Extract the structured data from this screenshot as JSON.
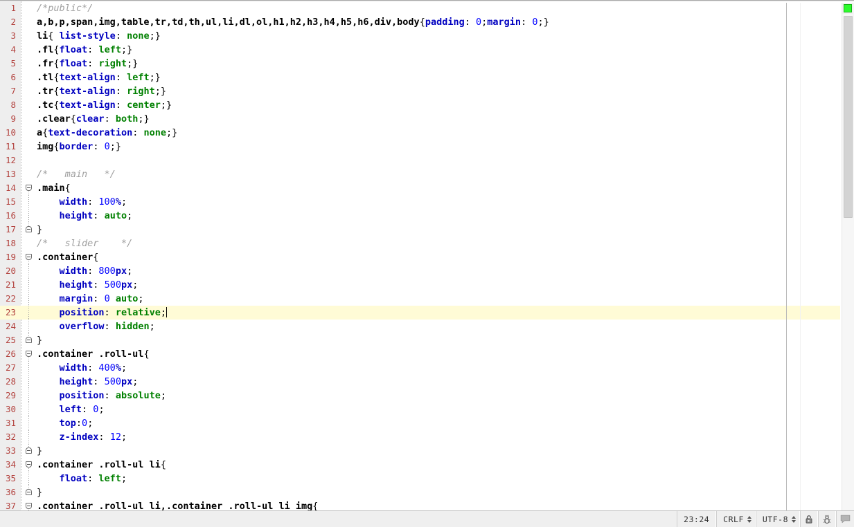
{
  "app": {
    "type": "code-editor",
    "language": "CSS"
  },
  "editor": {
    "current_line": 23,
    "first_visible_line": 1,
    "colors": {
      "background": "#ffffff",
      "gutter_background": "#eeeeee",
      "line_number": "#b3433f",
      "current_line_highlight": "#fffbd6",
      "selector": "#000000",
      "property": "#0000c0",
      "value_keyword": "#008000",
      "number": "#0000ff",
      "comment": "#a0a0a0",
      "caret": "#000000"
    },
    "lines": [
      {
        "n": 1,
        "fold": "none",
        "tokens": [
          {
            "t": "com",
            "s": "/*public*/"
          }
        ]
      },
      {
        "n": 2,
        "fold": "none",
        "tokens": [
          {
            "t": "sel",
            "s": "a,b,p,span,img,table,tr,td,th,ul,li,dl,ol,h1,h2,h3,h4,h5,h6,div,body"
          },
          {
            "t": "punc",
            "s": "{"
          },
          {
            "t": "prop",
            "s": "padding"
          },
          {
            "t": "punc",
            "s": ": "
          },
          {
            "t": "num",
            "s": "0"
          },
          {
            "t": "punc",
            "s": ";"
          },
          {
            "t": "prop",
            "s": "margin"
          },
          {
            "t": "punc",
            "s": ": "
          },
          {
            "t": "num",
            "s": "0"
          },
          {
            "t": "punc",
            "s": ";}"
          }
        ]
      },
      {
        "n": 3,
        "fold": "none",
        "tokens": [
          {
            "t": "sel",
            "s": "li"
          },
          {
            "t": "punc",
            "s": "{ "
          },
          {
            "t": "prop",
            "s": "list-style"
          },
          {
            "t": "punc",
            "s": ": "
          },
          {
            "t": "val",
            "s": "none"
          },
          {
            "t": "punc",
            "s": ";}"
          }
        ]
      },
      {
        "n": 4,
        "fold": "none",
        "tokens": [
          {
            "t": "sel",
            "s": ".fl"
          },
          {
            "t": "punc",
            "s": "{"
          },
          {
            "t": "prop",
            "s": "float"
          },
          {
            "t": "punc",
            "s": ": "
          },
          {
            "t": "val",
            "s": "left"
          },
          {
            "t": "punc",
            "s": ";}"
          }
        ]
      },
      {
        "n": 5,
        "fold": "none",
        "tokens": [
          {
            "t": "sel",
            "s": ".fr"
          },
          {
            "t": "punc",
            "s": "{"
          },
          {
            "t": "prop",
            "s": "float"
          },
          {
            "t": "punc",
            "s": ": "
          },
          {
            "t": "val",
            "s": "right"
          },
          {
            "t": "punc",
            "s": ";}"
          }
        ]
      },
      {
        "n": 6,
        "fold": "none",
        "tokens": [
          {
            "t": "sel",
            "s": ".tl"
          },
          {
            "t": "punc",
            "s": "{"
          },
          {
            "t": "prop",
            "s": "text-align"
          },
          {
            "t": "punc",
            "s": ": "
          },
          {
            "t": "val",
            "s": "left"
          },
          {
            "t": "punc",
            "s": ";}"
          }
        ]
      },
      {
        "n": 7,
        "fold": "none",
        "tokens": [
          {
            "t": "sel",
            "s": ".tr"
          },
          {
            "t": "punc",
            "s": "{"
          },
          {
            "t": "prop",
            "s": "text-align"
          },
          {
            "t": "punc",
            "s": ": "
          },
          {
            "t": "val",
            "s": "right"
          },
          {
            "t": "punc",
            "s": ";}"
          }
        ]
      },
      {
        "n": 8,
        "fold": "none",
        "tokens": [
          {
            "t": "sel",
            "s": ".tc"
          },
          {
            "t": "punc",
            "s": "{"
          },
          {
            "t": "prop",
            "s": "text-align"
          },
          {
            "t": "punc",
            "s": ": "
          },
          {
            "t": "val",
            "s": "center"
          },
          {
            "t": "punc",
            "s": ";}"
          }
        ]
      },
      {
        "n": 9,
        "fold": "none",
        "tokens": [
          {
            "t": "sel",
            "s": ".clear"
          },
          {
            "t": "punc",
            "s": "{"
          },
          {
            "t": "prop",
            "s": "clear"
          },
          {
            "t": "punc",
            "s": ": "
          },
          {
            "t": "val",
            "s": "both"
          },
          {
            "t": "punc",
            "s": ";}"
          }
        ]
      },
      {
        "n": 10,
        "fold": "none",
        "tokens": [
          {
            "t": "sel",
            "s": "a"
          },
          {
            "t": "punc",
            "s": "{"
          },
          {
            "t": "prop",
            "s": "text-decoration"
          },
          {
            "t": "punc",
            "s": ": "
          },
          {
            "t": "val",
            "s": "none"
          },
          {
            "t": "punc",
            "s": ";}"
          }
        ]
      },
      {
        "n": 11,
        "fold": "none",
        "tokens": [
          {
            "t": "sel",
            "s": "img"
          },
          {
            "t": "punc",
            "s": "{"
          },
          {
            "t": "prop",
            "s": "border"
          },
          {
            "t": "punc",
            "s": ": "
          },
          {
            "t": "num",
            "s": "0"
          },
          {
            "t": "punc",
            "s": ";}"
          }
        ]
      },
      {
        "n": 12,
        "fold": "none",
        "tokens": []
      },
      {
        "n": 13,
        "fold": "none",
        "tokens": [
          {
            "t": "com",
            "s": "/*   main   */"
          }
        ]
      },
      {
        "n": 14,
        "fold": "start",
        "tokens": [
          {
            "t": "sel",
            "s": ".main"
          },
          {
            "t": "punc",
            "s": "{"
          }
        ]
      },
      {
        "n": 15,
        "fold": "none",
        "tokens": [
          {
            "t": "punc",
            "s": "    "
          },
          {
            "t": "prop",
            "s": "width"
          },
          {
            "t": "punc",
            "s": ": "
          },
          {
            "t": "num",
            "s": "100"
          },
          {
            "t": "unit",
            "s": "%"
          },
          {
            "t": "punc",
            "s": ";"
          }
        ]
      },
      {
        "n": 16,
        "fold": "none",
        "tokens": [
          {
            "t": "punc",
            "s": "    "
          },
          {
            "t": "prop",
            "s": "height"
          },
          {
            "t": "punc",
            "s": ": "
          },
          {
            "t": "val",
            "s": "auto"
          },
          {
            "t": "punc",
            "s": ";"
          }
        ]
      },
      {
        "n": 17,
        "fold": "end",
        "tokens": [
          {
            "t": "punc",
            "s": "}"
          }
        ]
      },
      {
        "n": 18,
        "fold": "none",
        "tokens": [
          {
            "t": "com",
            "s": "/*   slider    */"
          }
        ]
      },
      {
        "n": 19,
        "fold": "start",
        "tokens": [
          {
            "t": "sel",
            "s": ".container"
          },
          {
            "t": "punc",
            "s": "{"
          }
        ]
      },
      {
        "n": 20,
        "fold": "none",
        "tokens": [
          {
            "t": "punc",
            "s": "    "
          },
          {
            "t": "prop",
            "s": "width"
          },
          {
            "t": "punc",
            "s": ": "
          },
          {
            "t": "num",
            "s": "800"
          },
          {
            "t": "unit",
            "s": "px"
          },
          {
            "t": "punc",
            "s": ";"
          }
        ]
      },
      {
        "n": 21,
        "fold": "none",
        "tokens": [
          {
            "t": "punc",
            "s": "    "
          },
          {
            "t": "prop",
            "s": "height"
          },
          {
            "t": "punc",
            "s": ": "
          },
          {
            "t": "num",
            "s": "500"
          },
          {
            "t": "unit",
            "s": "px"
          },
          {
            "t": "punc",
            "s": ";"
          }
        ]
      },
      {
        "n": 22,
        "fold": "none",
        "tokens": [
          {
            "t": "punc",
            "s": "    "
          },
          {
            "t": "prop",
            "s": "margin"
          },
          {
            "t": "punc",
            "s": ": "
          },
          {
            "t": "num",
            "s": "0"
          },
          {
            "t": "punc",
            "s": " "
          },
          {
            "t": "val",
            "s": "auto"
          },
          {
            "t": "punc",
            "s": ";"
          }
        ]
      },
      {
        "n": 23,
        "fold": "none",
        "caret": true,
        "tokens": [
          {
            "t": "punc",
            "s": "    "
          },
          {
            "t": "prop",
            "s": "position"
          },
          {
            "t": "punc",
            "s": ": "
          },
          {
            "t": "val",
            "s": "relative"
          },
          {
            "t": "punc",
            "s": ";"
          }
        ]
      },
      {
        "n": 24,
        "fold": "none",
        "tokens": [
          {
            "t": "punc",
            "s": "    "
          },
          {
            "t": "prop",
            "s": "overflow"
          },
          {
            "t": "punc",
            "s": ": "
          },
          {
            "t": "val",
            "s": "hidden"
          },
          {
            "t": "punc",
            "s": ";"
          }
        ]
      },
      {
        "n": 25,
        "fold": "end",
        "tokens": [
          {
            "t": "punc",
            "s": "}"
          }
        ]
      },
      {
        "n": 26,
        "fold": "start",
        "tokens": [
          {
            "t": "sel",
            "s": ".container .roll-ul"
          },
          {
            "t": "punc",
            "s": "{"
          }
        ]
      },
      {
        "n": 27,
        "fold": "none",
        "tokens": [
          {
            "t": "punc",
            "s": "    "
          },
          {
            "t": "prop",
            "s": "width"
          },
          {
            "t": "punc",
            "s": ": "
          },
          {
            "t": "num",
            "s": "400"
          },
          {
            "t": "unit",
            "s": "%"
          },
          {
            "t": "punc",
            "s": ";"
          }
        ]
      },
      {
        "n": 28,
        "fold": "none",
        "tokens": [
          {
            "t": "punc",
            "s": "    "
          },
          {
            "t": "prop",
            "s": "height"
          },
          {
            "t": "punc",
            "s": ": "
          },
          {
            "t": "num",
            "s": "500"
          },
          {
            "t": "unit",
            "s": "px"
          },
          {
            "t": "punc",
            "s": ";"
          }
        ]
      },
      {
        "n": 29,
        "fold": "none",
        "tokens": [
          {
            "t": "punc",
            "s": "    "
          },
          {
            "t": "prop",
            "s": "position"
          },
          {
            "t": "punc",
            "s": ": "
          },
          {
            "t": "val",
            "s": "absolute"
          },
          {
            "t": "punc",
            "s": ";"
          }
        ]
      },
      {
        "n": 30,
        "fold": "none",
        "tokens": [
          {
            "t": "punc",
            "s": "    "
          },
          {
            "t": "prop",
            "s": "left"
          },
          {
            "t": "punc",
            "s": ": "
          },
          {
            "t": "num",
            "s": "0"
          },
          {
            "t": "punc",
            "s": ";"
          }
        ]
      },
      {
        "n": 31,
        "fold": "none",
        "tokens": [
          {
            "t": "punc",
            "s": "    "
          },
          {
            "t": "prop",
            "s": "top"
          },
          {
            "t": "punc",
            "s": ":"
          },
          {
            "t": "num",
            "s": "0"
          },
          {
            "t": "punc",
            "s": ";"
          }
        ]
      },
      {
        "n": 32,
        "fold": "none",
        "tokens": [
          {
            "t": "punc",
            "s": "    "
          },
          {
            "t": "prop",
            "s": "z-index"
          },
          {
            "t": "punc",
            "s": ": "
          },
          {
            "t": "num",
            "s": "12"
          },
          {
            "t": "punc",
            "s": ";"
          }
        ]
      },
      {
        "n": 33,
        "fold": "end",
        "tokens": [
          {
            "t": "punc",
            "s": "}"
          }
        ]
      },
      {
        "n": 34,
        "fold": "start",
        "tokens": [
          {
            "t": "sel",
            "s": ".container .roll-ul li"
          },
          {
            "t": "punc",
            "s": "{"
          }
        ]
      },
      {
        "n": 35,
        "fold": "none",
        "tokens": [
          {
            "t": "punc",
            "s": "    "
          },
          {
            "t": "prop",
            "s": "float"
          },
          {
            "t": "punc",
            "s": ": "
          },
          {
            "t": "val",
            "s": "left"
          },
          {
            "t": "punc",
            "s": ";"
          }
        ]
      },
      {
        "n": 36,
        "fold": "end",
        "tokens": [
          {
            "t": "punc",
            "s": "}"
          }
        ]
      },
      {
        "n": 37,
        "fold": "start",
        "tokens": [
          {
            "t": "sel",
            "s": ".container .roll-ul li,.container .roll-ul li img"
          },
          {
            "t": "punc",
            "s": "{"
          }
        ]
      }
    ]
  },
  "scrollbar": {
    "inspection_status_color": "#2dfb2d",
    "thumb_color": "#d3d3d3"
  },
  "status_bar": {
    "caret_position": "23:24",
    "line_separator": "CRLF",
    "encoding": "UTF-8",
    "icons": [
      {
        "name": "lock-icon",
        "title": "Toggle read-only attribute"
      },
      {
        "name": "ant-icon",
        "title": "Background tasks"
      },
      {
        "name": "event-log-icon",
        "title": "Event log"
      }
    ]
  }
}
